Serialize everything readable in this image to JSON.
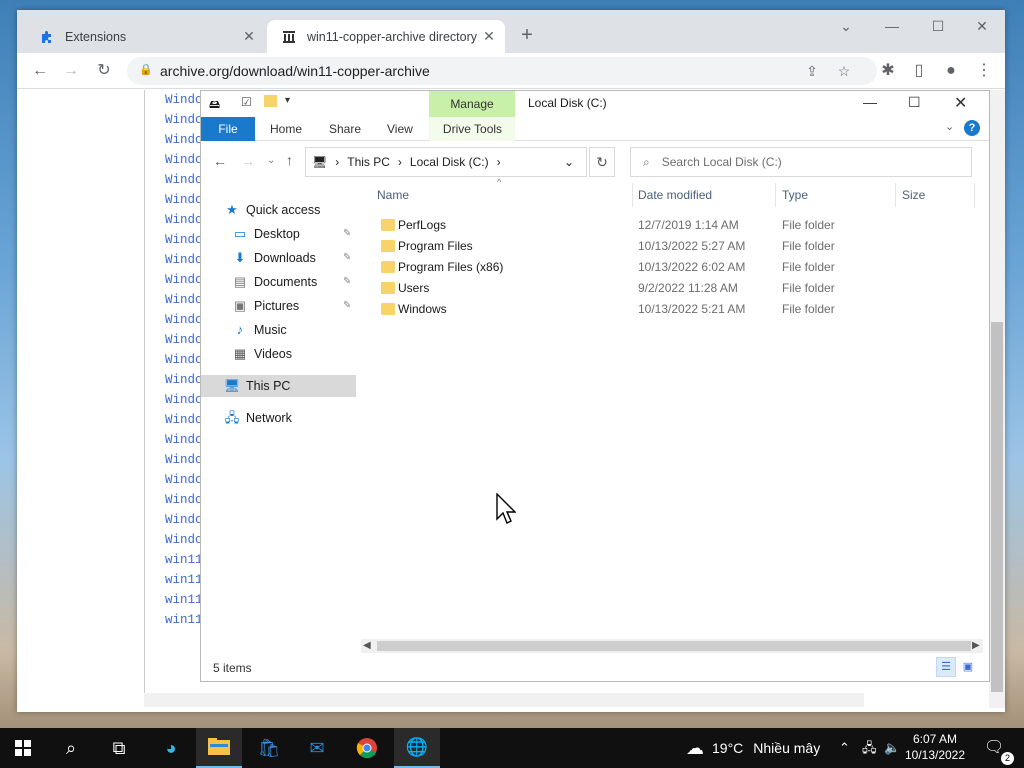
{
  "browser": {
    "tabs": [
      {
        "label": "Extensions",
        "icon": "puzzle-icon"
      },
      {
        "label": "win11-copper-archive directory l",
        "icon": "archive-icon"
      }
    ],
    "url": "archive.org/download/win11-copper-archive"
  },
  "listing": {
    "items": [
      "Windo",
      "Windo",
      "Windo",
      "Windo",
      "Windo",
      "Windo",
      "Windo",
      "Windo",
      "Windo",
      "Windo",
      "Windo",
      "Windo",
      "Windo",
      "Windo",
      "Windo",
      "Windo",
      "Windo",
      "Windo",
      "Windo",
      "Windo",
      "Windo",
      "Windo",
      "Windo",
      "win11",
      "win11",
      "win11",
      "win11"
    ]
  },
  "explorer": {
    "title": "Local Disk (C:)",
    "ribbon": {
      "manage": "Manage",
      "file": "File",
      "home": "Home",
      "share": "Share",
      "view": "View",
      "drive_tools": "Drive Tools"
    },
    "breadcrumb": [
      "This PC",
      "Local Disk (C:)"
    ],
    "search_placeholder": "Search Local Disk (C:)",
    "nav": {
      "quick_access": "Quick access",
      "desktop": "Desktop",
      "downloads": "Downloads",
      "documents": "Documents",
      "pictures": "Pictures",
      "music": "Music",
      "videos": "Videos",
      "this_pc": "This PC",
      "network": "Network"
    },
    "columns": {
      "name": "Name",
      "date": "Date modified",
      "type": "Type",
      "size": "Size"
    },
    "rows": [
      {
        "name": "PerfLogs",
        "date": "12/7/2019 1:14 AM",
        "type": "File folder"
      },
      {
        "name": "Program Files",
        "date": "10/13/2022 5:27 AM",
        "type": "File folder"
      },
      {
        "name": "Program Files (x86)",
        "date": "10/13/2022 6:02 AM",
        "type": "File folder"
      },
      {
        "name": "Users",
        "date": "9/2/2022 11:28 AM",
        "type": "File folder"
      },
      {
        "name": "Windows",
        "date": "10/13/2022 5:21 AM",
        "type": "File folder"
      }
    ],
    "status": "5 items"
  },
  "taskbar": {
    "weather": {
      "temp": "19°C",
      "condition": "Nhiều mây"
    },
    "time": "6:07 AM",
    "date": "10/13/2022",
    "notifications": "2"
  }
}
